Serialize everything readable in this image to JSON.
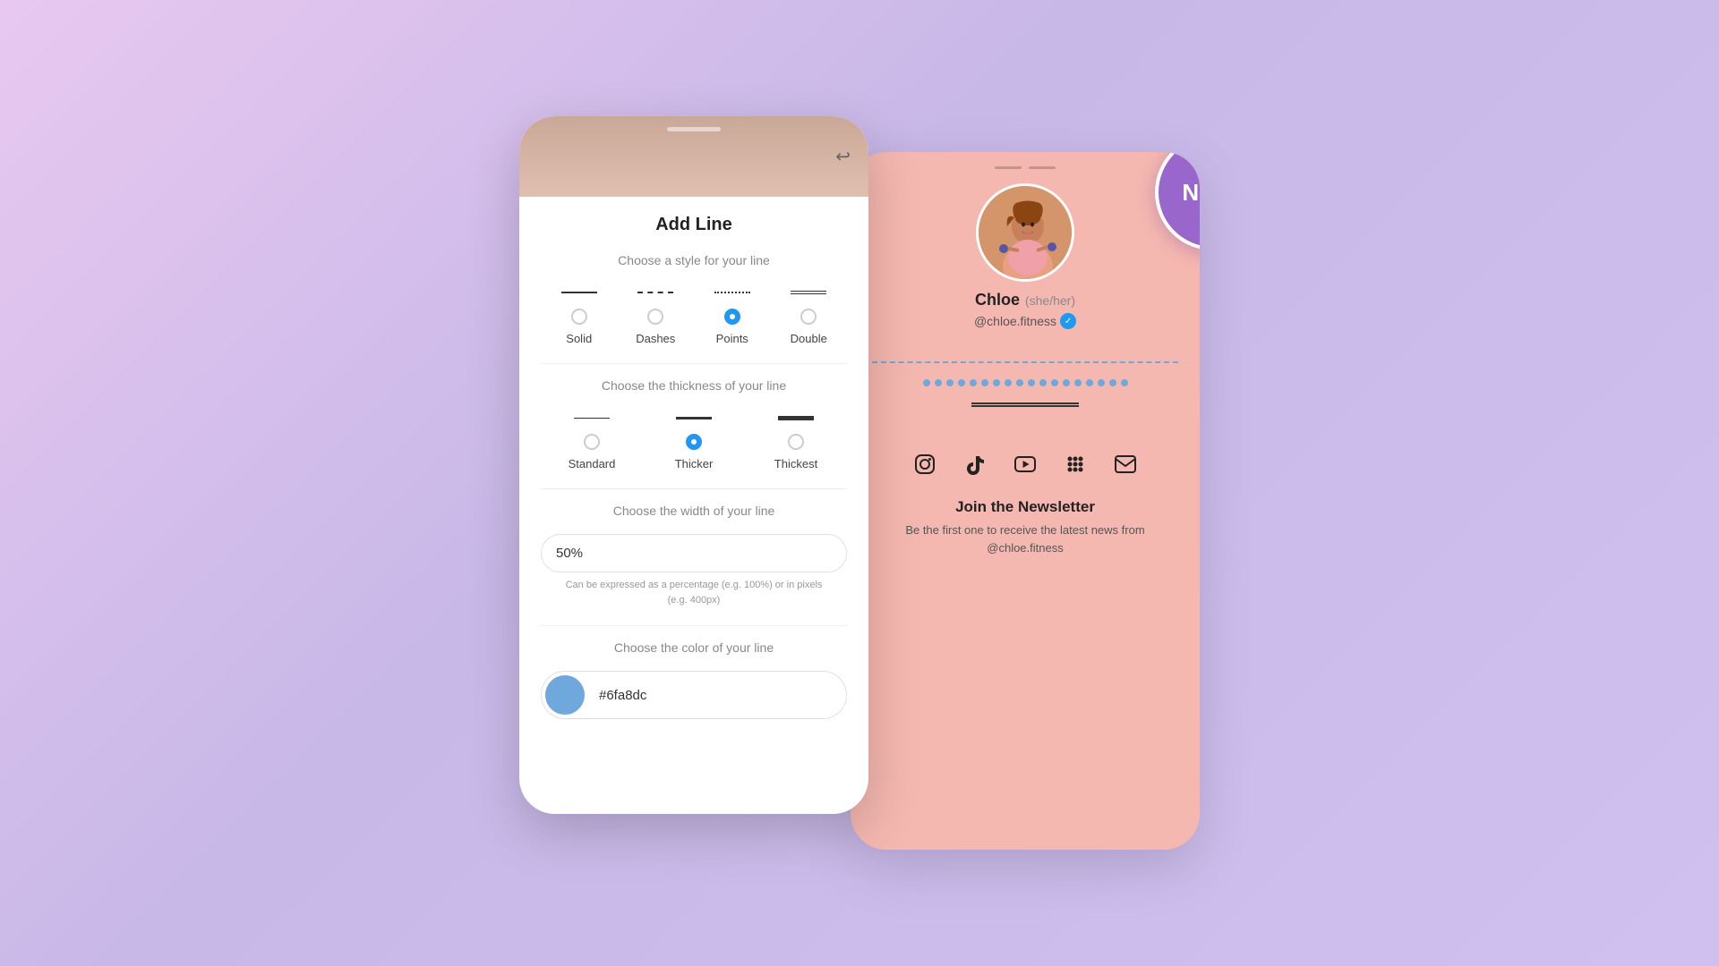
{
  "background": "#c8b8e8",
  "new_badge": "NEW!",
  "left_phone": {
    "title": "Add Line",
    "style_section": {
      "label": "Choose a style for your line",
      "options": [
        {
          "id": "solid",
          "label": "Solid",
          "selected": false
        },
        {
          "id": "dashes",
          "label": "Dashes",
          "selected": false
        },
        {
          "id": "points",
          "label": "Points",
          "selected": true
        },
        {
          "id": "double",
          "label": "Double",
          "selected": false
        }
      ]
    },
    "thickness_section": {
      "label": "Choose the thickness of your line",
      "options": [
        {
          "id": "standard",
          "label": "Standard",
          "selected": false
        },
        {
          "id": "thicker",
          "label": "Thicker",
          "selected": true
        },
        {
          "id": "thickest",
          "label": "Thickest",
          "selected": false
        }
      ]
    },
    "width_section": {
      "label": "Choose the width of your line",
      "value": "50%",
      "hint": "Can be expressed as a percentage (e.g. 100%) or in pixels\n(e.g. 400px)"
    },
    "color_section": {
      "label": "Choose the color of your line",
      "value": "#6fa8dc",
      "swatch_color": "#6fa8dc"
    }
  },
  "right_phone": {
    "profile": {
      "name": "Chloe",
      "pronouns": "(she/her)",
      "handle": "@chloe.fitness",
      "verified": true
    },
    "newsletter": {
      "title": "Join the Newsletter",
      "text": "Be the first one to receive the latest news from @chloe.fitness"
    },
    "social_icons": [
      "instagram",
      "tiktok",
      "youtube",
      "podcasts",
      "mail"
    ]
  }
}
